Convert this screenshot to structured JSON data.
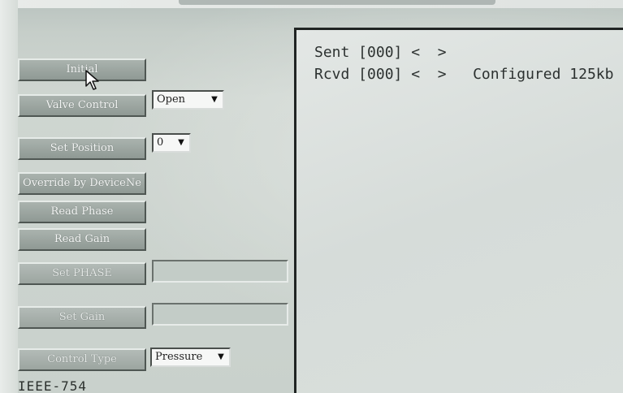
{
  "buttons": {
    "initial": "Initial",
    "valve_control": "Valve Control",
    "set_position": "Set Position",
    "override": "Override by DeviceNe",
    "read_phase": "Read Phase",
    "read_gain": "Read Gain",
    "set_phase": "Set PHASE",
    "set_gain": "Set Gain",
    "control_type": "Control Type"
  },
  "dropdowns": {
    "valve_control_value": "Open",
    "set_position_value": "0",
    "control_type_value": "Pressure"
  },
  "icons": {
    "dropdown_arrow": "▼",
    "pointer": "mouse-pointer-icon"
  },
  "footer": {
    "label": "IEEE-754"
  },
  "log": {
    "line1": "Sent [000] <  >",
    "line2": "Rcvd [000] <  >   Configured 125kb"
  }
}
